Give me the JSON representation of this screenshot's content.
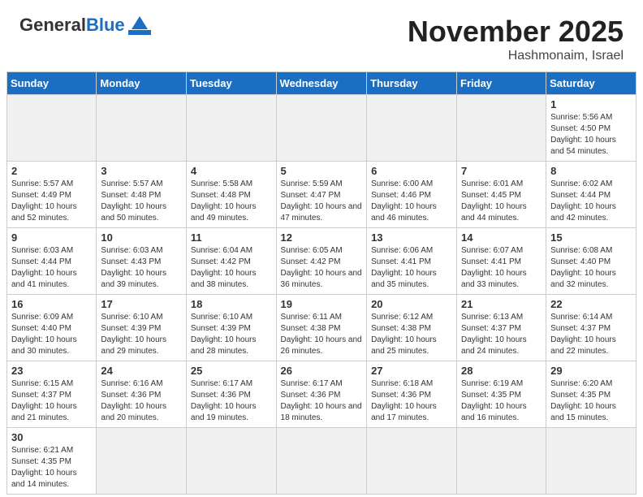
{
  "header": {
    "logo_general": "General",
    "logo_blue": "Blue",
    "month_title": "November 2025",
    "location": "Hashmonaim, Israel"
  },
  "weekdays": [
    "Sunday",
    "Monday",
    "Tuesday",
    "Wednesday",
    "Thursday",
    "Friday",
    "Saturday"
  ],
  "weeks": [
    [
      {
        "day": "",
        "info": "",
        "empty": true
      },
      {
        "day": "",
        "info": "",
        "empty": true
      },
      {
        "day": "",
        "info": "",
        "empty": true
      },
      {
        "day": "",
        "info": "",
        "empty": true
      },
      {
        "day": "",
        "info": "",
        "empty": true
      },
      {
        "day": "",
        "info": "",
        "empty": true
      },
      {
        "day": "1",
        "info": "Sunrise: 5:56 AM\nSunset: 4:50 PM\nDaylight: 10 hours\nand 54 minutes."
      }
    ],
    [
      {
        "day": "2",
        "info": "Sunrise: 5:57 AM\nSunset: 4:49 PM\nDaylight: 10 hours\nand 52 minutes."
      },
      {
        "day": "3",
        "info": "Sunrise: 5:57 AM\nSunset: 4:48 PM\nDaylight: 10 hours\nand 50 minutes."
      },
      {
        "day": "4",
        "info": "Sunrise: 5:58 AM\nSunset: 4:48 PM\nDaylight: 10 hours\nand 49 minutes."
      },
      {
        "day": "5",
        "info": "Sunrise: 5:59 AM\nSunset: 4:47 PM\nDaylight: 10 hours\nand 47 minutes."
      },
      {
        "day": "6",
        "info": "Sunrise: 6:00 AM\nSunset: 4:46 PM\nDaylight: 10 hours\nand 46 minutes."
      },
      {
        "day": "7",
        "info": "Sunrise: 6:01 AM\nSunset: 4:45 PM\nDaylight: 10 hours\nand 44 minutes."
      },
      {
        "day": "8",
        "info": "Sunrise: 6:02 AM\nSunset: 4:44 PM\nDaylight: 10 hours\nand 42 minutes."
      }
    ],
    [
      {
        "day": "9",
        "info": "Sunrise: 6:03 AM\nSunset: 4:44 PM\nDaylight: 10 hours\nand 41 minutes."
      },
      {
        "day": "10",
        "info": "Sunrise: 6:03 AM\nSunset: 4:43 PM\nDaylight: 10 hours\nand 39 minutes."
      },
      {
        "day": "11",
        "info": "Sunrise: 6:04 AM\nSunset: 4:42 PM\nDaylight: 10 hours\nand 38 minutes."
      },
      {
        "day": "12",
        "info": "Sunrise: 6:05 AM\nSunset: 4:42 PM\nDaylight: 10 hours\nand 36 minutes."
      },
      {
        "day": "13",
        "info": "Sunrise: 6:06 AM\nSunset: 4:41 PM\nDaylight: 10 hours\nand 35 minutes."
      },
      {
        "day": "14",
        "info": "Sunrise: 6:07 AM\nSunset: 4:41 PM\nDaylight: 10 hours\nand 33 minutes."
      },
      {
        "day": "15",
        "info": "Sunrise: 6:08 AM\nSunset: 4:40 PM\nDaylight: 10 hours\nand 32 minutes."
      }
    ],
    [
      {
        "day": "16",
        "info": "Sunrise: 6:09 AM\nSunset: 4:40 PM\nDaylight: 10 hours\nand 30 minutes."
      },
      {
        "day": "17",
        "info": "Sunrise: 6:10 AM\nSunset: 4:39 PM\nDaylight: 10 hours\nand 29 minutes."
      },
      {
        "day": "18",
        "info": "Sunrise: 6:10 AM\nSunset: 4:39 PM\nDaylight: 10 hours\nand 28 minutes."
      },
      {
        "day": "19",
        "info": "Sunrise: 6:11 AM\nSunset: 4:38 PM\nDaylight: 10 hours\nand 26 minutes."
      },
      {
        "day": "20",
        "info": "Sunrise: 6:12 AM\nSunset: 4:38 PM\nDaylight: 10 hours\nand 25 minutes."
      },
      {
        "day": "21",
        "info": "Sunrise: 6:13 AM\nSunset: 4:37 PM\nDaylight: 10 hours\nand 24 minutes."
      },
      {
        "day": "22",
        "info": "Sunrise: 6:14 AM\nSunset: 4:37 PM\nDaylight: 10 hours\nand 22 minutes."
      }
    ],
    [
      {
        "day": "23",
        "info": "Sunrise: 6:15 AM\nSunset: 4:37 PM\nDaylight: 10 hours\nand 21 minutes."
      },
      {
        "day": "24",
        "info": "Sunrise: 6:16 AM\nSunset: 4:36 PM\nDaylight: 10 hours\nand 20 minutes."
      },
      {
        "day": "25",
        "info": "Sunrise: 6:17 AM\nSunset: 4:36 PM\nDaylight: 10 hours\nand 19 minutes."
      },
      {
        "day": "26",
        "info": "Sunrise: 6:17 AM\nSunset: 4:36 PM\nDaylight: 10 hours\nand 18 minutes."
      },
      {
        "day": "27",
        "info": "Sunrise: 6:18 AM\nSunset: 4:36 PM\nDaylight: 10 hours\nand 17 minutes."
      },
      {
        "day": "28",
        "info": "Sunrise: 6:19 AM\nSunset: 4:35 PM\nDaylight: 10 hours\nand 16 minutes."
      },
      {
        "day": "29",
        "info": "Sunrise: 6:20 AM\nSunset: 4:35 PM\nDaylight: 10 hours\nand 15 minutes."
      }
    ],
    [
      {
        "day": "30",
        "info": "Sunrise: 6:21 AM\nSunset: 4:35 PM\nDaylight: 10 hours\nand 14 minutes."
      },
      {
        "day": "",
        "info": "",
        "empty": true
      },
      {
        "day": "",
        "info": "",
        "empty": true
      },
      {
        "day": "",
        "info": "",
        "empty": true
      },
      {
        "day": "",
        "info": "",
        "empty": true
      },
      {
        "day": "",
        "info": "",
        "empty": true
      },
      {
        "day": "",
        "info": "",
        "empty": true
      }
    ]
  ]
}
